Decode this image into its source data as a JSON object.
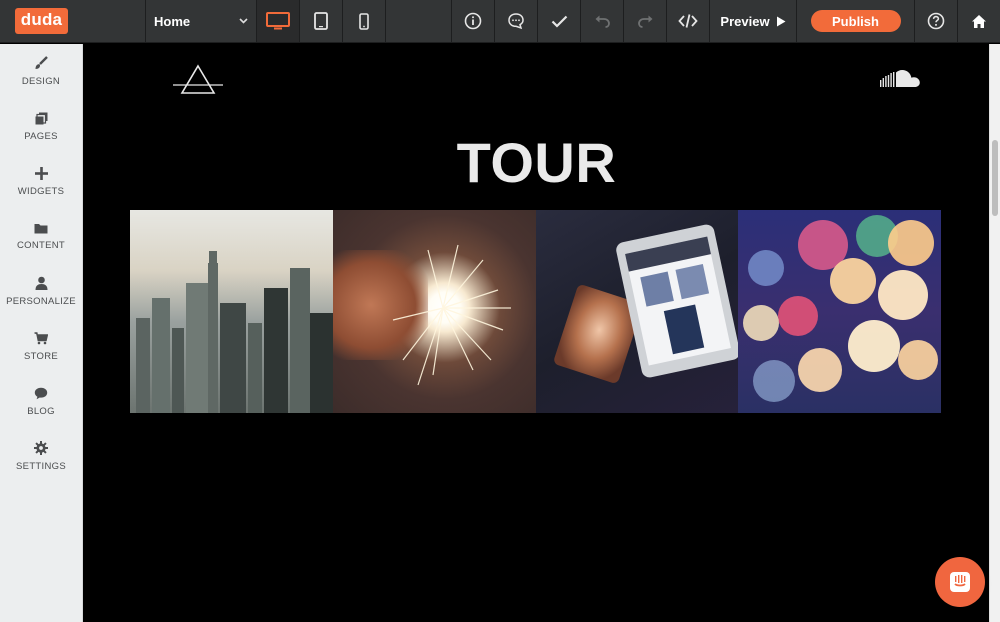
{
  "topbar": {
    "logo": "duda",
    "page_select": {
      "value": "Home"
    },
    "preview_label": "Preview",
    "publish_label": "Publish",
    "icons": [
      "desktop-icon",
      "tablet-icon",
      "mobile-icon",
      "info-icon",
      "comment-icon",
      "check-icon",
      "undo-icon",
      "redo-icon",
      "code-icon",
      "help-icon",
      "home-icon"
    ]
  },
  "sidebar": {
    "items": [
      {
        "label": "DESIGN",
        "icon": "brush-icon"
      },
      {
        "label": "PAGES",
        "icon": "pages-icon"
      },
      {
        "label": "WIDGETS",
        "icon": "plus-icon"
      },
      {
        "label": "CONTENT",
        "icon": "folder-icon"
      },
      {
        "label": "PERSONALIZE",
        "icon": "person-icon"
      },
      {
        "label": "STORE",
        "icon": "cart-icon"
      },
      {
        "label": "BLOG",
        "icon": "speech-bubble-icon"
      },
      {
        "label": "SETTINGS",
        "icon": "gear-icon"
      }
    ]
  },
  "canvas": {
    "title": "TOUR",
    "gallery": [
      "city-skyline-photo",
      "sparkler-photo",
      "tablet-photo",
      "bokeh-lights-photo"
    ]
  },
  "colors": {
    "accent": "#f26b3a",
    "topbar": "#333536",
    "sidebar": "#eceeef",
    "canvas": "#000000"
  }
}
